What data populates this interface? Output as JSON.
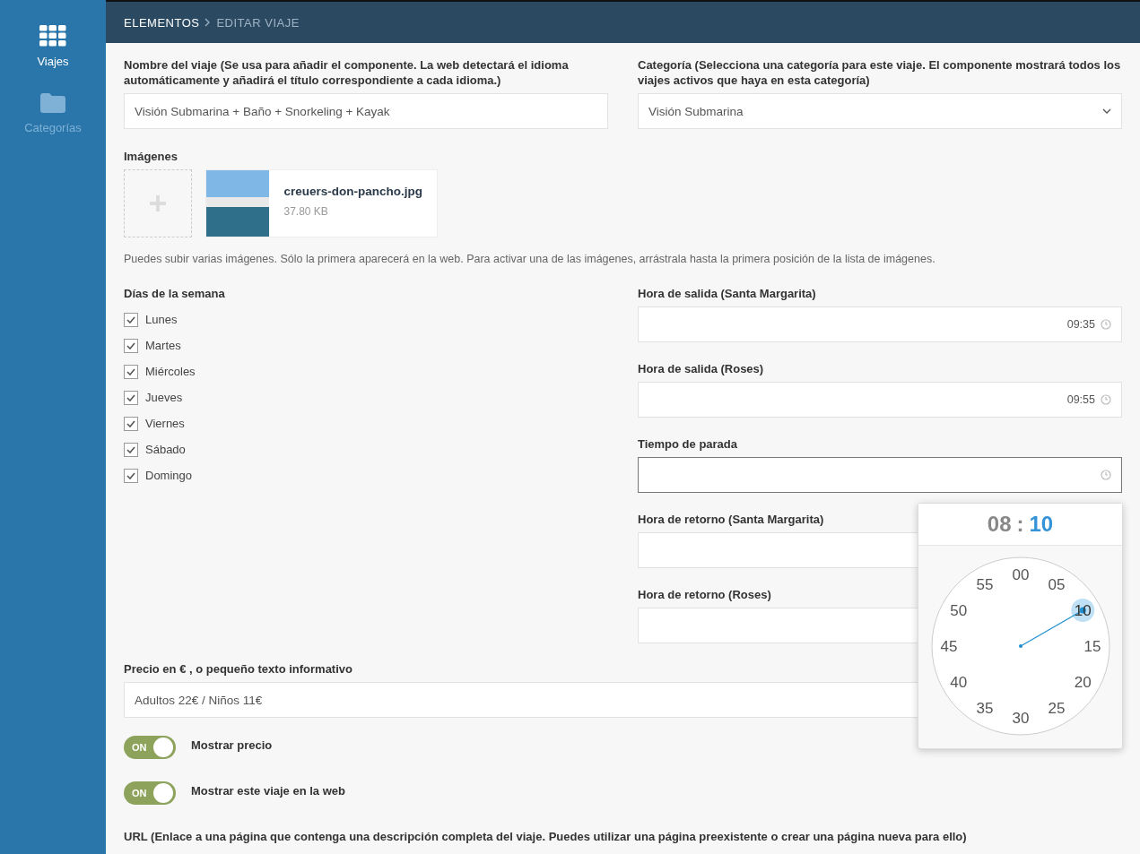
{
  "sidebar": {
    "items": [
      {
        "label": "Viajes",
        "selected": true
      },
      {
        "label": "Categorías",
        "selected": false
      }
    ]
  },
  "breadcrumb": [
    "ELEMENTOS",
    "EDITAR VIAJE"
  ],
  "name_field": {
    "label": "Nombre del viaje (Se usa para añadir el componente. La web detectará el idioma automáticamente y añadirá el título correspondiente a cada idioma.)",
    "value": "Visión Submarina + Baño + Snorkeling + Kayak"
  },
  "category_field": {
    "label": "Categoría (Selecciona una categoría para este viaje. El componente mostrará todos los viajes activos que haya en esta categoría)",
    "value": "Visión Submarina"
  },
  "images": {
    "label": "Imágenes",
    "files": [
      {
        "name": "creuers-don-pancho.jpg",
        "size": "37.80 KB"
      }
    ],
    "hint": "Puedes subir varias imágenes. Sólo la primera aparecerá en la web. Para activar una de las imágenes, arrástrala hasta la primera posición de la lista de imágenes."
  },
  "weekdays": {
    "label": "Días de la semana",
    "days": [
      {
        "label": "Lunes",
        "checked": true
      },
      {
        "label": "Martes",
        "checked": true
      },
      {
        "label": "Miércoles",
        "checked": true
      },
      {
        "label": "Jueves",
        "checked": true
      },
      {
        "label": "Viernes",
        "checked": true
      },
      {
        "label": "Sábado",
        "checked": true
      },
      {
        "label": "Domingo",
        "checked": true
      }
    ]
  },
  "time_fields": [
    {
      "label": "Hora de salida (Santa Margarita)",
      "value": "09:35",
      "focused": false
    },
    {
      "label": "Hora de salida (Roses)",
      "value": "09:55",
      "focused": false
    },
    {
      "label": "Tiempo de parada",
      "focused": true
    },
    {
      "label": "Hora de retorno (Santa Margarita)",
      "focused": false
    },
    {
      "label": "Hora de retorno (Roses)",
      "focused": false
    }
  ],
  "time_picker": {
    "hours": "08",
    "separator": ":",
    "minutes": "10",
    "dial": [
      {
        "label": "00",
        "selected": false
      },
      {
        "label": "05",
        "selected": false
      },
      {
        "label": "10",
        "selected": true
      },
      {
        "label": "15",
        "selected": false
      },
      {
        "label": "20",
        "selected": false
      },
      {
        "label": "25",
        "selected": false
      },
      {
        "label": "30",
        "selected": false
      },
      {
        "label": "35",
        "selected": false
      },
      {
        "label": "40",
        "selected": false
      },
      {
        "label": "45",
        "selected": false
      },
      {
        "label": "50",
        "selected": false
      },
      {
        "label": "55",
        "selected": false
      }
    ]
  },
  "price_field": {
    "label": "Precio en € , o pequeño texto informativo",
    "value": "Adultos 22€ / Niños 11€"
  },
  "toggles": [
    {
      "state_label": "ON",
      "on": true,
      "label": "Mostrar precio"
    },
    {
      "state_label": "ON",
      "on": true,
      "label": "Mostrar este viaje en la web"
    }
  ],
  "url_label": "URL (Enlace a una página que contenga una descripción completa del viaje. Puedes utilizar una página preexistente o crear una página nueva para ello)"
}
